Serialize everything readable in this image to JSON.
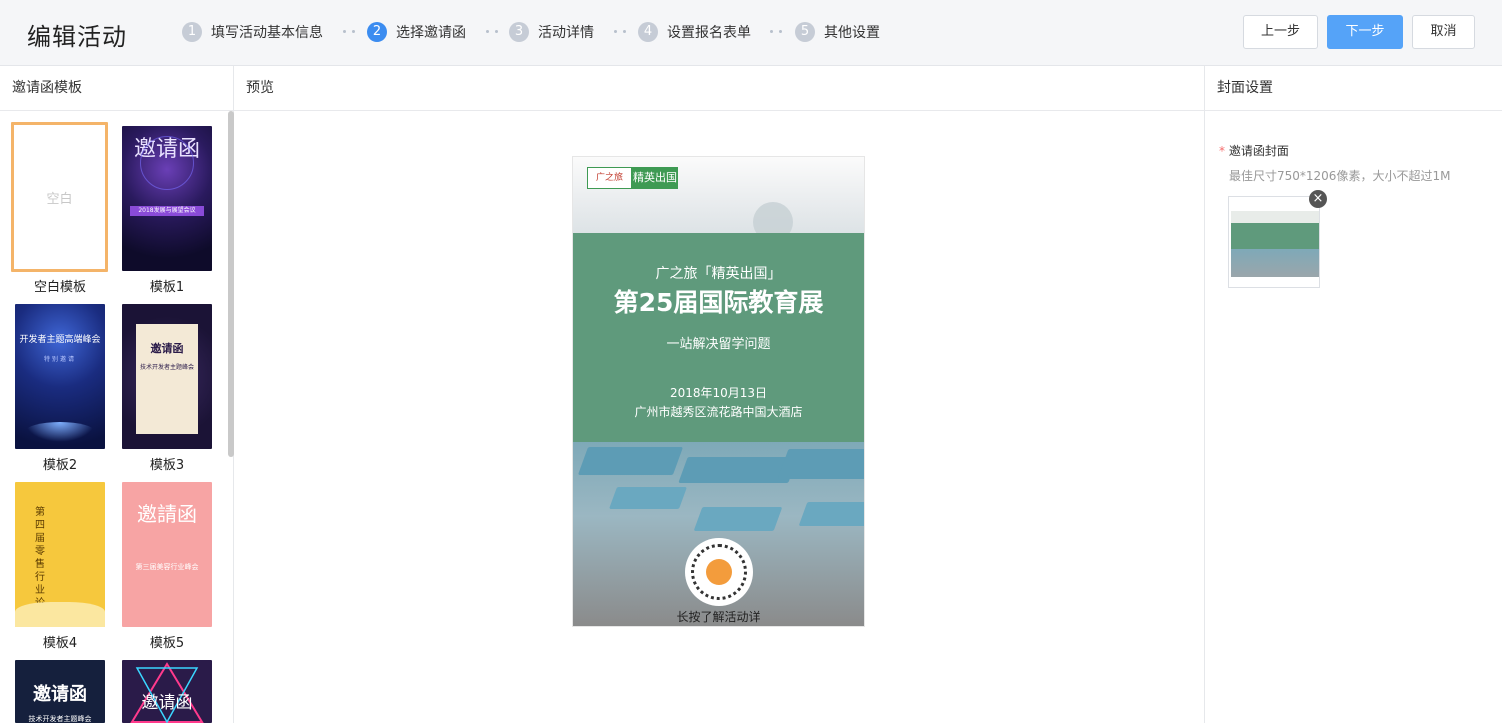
{
  "header": {
    "title": "编辑活动",
    "steps": [
      {
        "num": "1",
        "label": "填写活动基本信息"
      },
      {
        "num": "2",
        "label": "选择邀请函"
      },
      {
        "num": "3",
        "label": "活动详情"
      },
      {
        "num": "4",
        "label": "设置报名表单"
      },
      {
        "num": "5",
        "label": "其他设置"
      }
    ],
    "active_step": 2,
    "buttons": {
      "prev": "上一步",
      "next": "下一步",
      "cancel": "取消"
    }
  },
  "templates_panel": {
    "title": "邀请函模板",
    "items": [
      {
        "label": "空白模板",
        "thumb_text": "空白"
      },
      {
        "label": "模板1",
        "thumb_text": "邀请函"
      },
      {
        "label": "模板2",
        "thumb_text": "开发者主题高端峰会"
      },
      {
        "label": "模板3",
        "thumb_text": "邀请函"
      },
      {
        "label": "模板4",
        "thumb_text": "第四届零售行业论坛"
      },
      {
        "label": "模板5",
        "thumb_text": "邀請函"
      },
      {
        "label": "",
        "thumb_text": "邀请函"
      },
      {
        "label": "",
        "thumb_text": "邀请函"
      }
    ],
    "template_details": {
      "t1_banner": "2018发展与展望会议",
      "t2_sub": "特别邀请",
      "t3_sub": "技术开发者主题峰会",
      "t5_sub": "第三届美容行业峰会",
      "t6_sub": "技术开发者主题峰会"
    }
  },
  "preview_panel": {
    "title": "预览",
    "poster": {
      "logo_left": "广之旅",
      "logo_right": "精英出国",
      "subtitle": "广之旅「精英出国」",
      "title": "第25届国际教育展",
      "tagline": "一站解决留学问题",
      "date": "2018年10月13日",
      "venue": "广州市越秀区流花路中国大酒店",
      "qr_caption": "长按了解活动详"
    }
  },
  "cover_panel": {
    "title": "封面设置",
    "field_label": "邀请函封面",
    "required_mark": "*",
    "hint": "最佳尺寸750*1206像素，大小不超过1M",
    "remove_icon": "×"
  },
  "colors": {
    "primary": "#55a3f8",
    "active_step": "#3b8cf0",
    "selected_border": "#f4b469",
    "poster_green": "#5f9a7c"
  }
}
